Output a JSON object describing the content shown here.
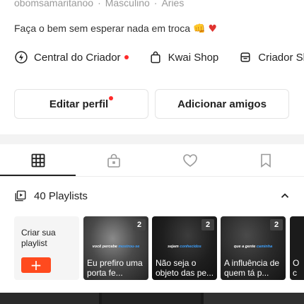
{
  "profile": {
    "username": "obomsamaritanoo",
    "gender": "Masculino",
    "sign": "Áries",
    "separator": "·",
    "bio": "Faça o bem sem esperar nada em troca",
    "bio_emoji_fist": "👊",
    "bio_emoji_heart": "♥"
  },
  "links": [
    {
      "label": "Central do Criador",
      "icon": "bolt-icon",
      "has_dot": true
    },
    {
      "label": "Kwai Shop",
      "icon": "shopping-bag-icon",
      "has_dot": false
    },
    {
      "label": "Criador Sh",
      "icon": "creator-shop-icon",
      "has_dot": false
    }
  ],
  "buttons": {
    "edit_profile": "Editar perfil",
    "add_friends": "Adicionar amigos"
  },
  "tabs": [
    {
      "name": "grid-icon",
      "active": true
    },
    {
      "name": "lock-icon",
      "active": false
    },
    {
      "name": "heart-outline-icon",
      "active": false
    },
    {
      "name": "bookmark-icon",
      "active": false
    }
  ],
  "playlists": {
    "count_label": "40 Playlists",
    "create_label": "Criar sua playlist",
    "create_button": "+",
    "items": [
      {
        "count": "2",
        "caption_a": "você percebe",
        "caption_b": "mostrou-se",
        "title": "Eu prefiro uma porta fe..."
      },
      {
        "count": "2",
        "caption_a": "sejam",
        "caption_b": "conhecidos",
        "title": "Não seja o objeto das pe..."
      },
      {
        "count": "2",
        "caption_a": "que a gente",
        "caption_b": "caminha",
        "title": "A influência de quem tá p..."
      },
      {
        "count": "",
        "caption_a": "",
        "caption_b": "",
        "title": "O c su"
      }
    ]
  },
  "colors": {
    "accent": "#ff4a1e",
    "dot_red": "#ff2a2a",
    "caption_highlight": "#3ea2ff"
  }
}
